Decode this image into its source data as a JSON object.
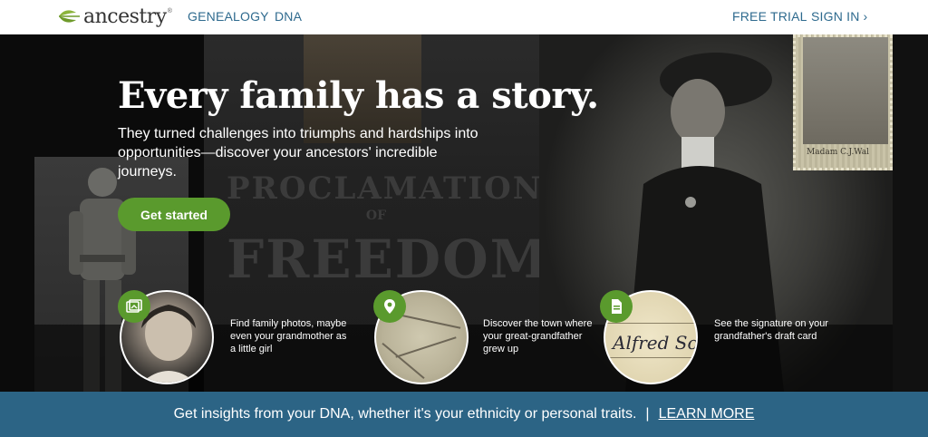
{
  "nav": {
    "logo_text": "ancestry",
    "logo_tm": "®",
    "genealogy": "GENEALOGY",
    "dna": "DNA",
    "free_trial": "FREE TRIAL",
    "sign_in": "SIGN IN"
  },
  "hero": {
    "title": "Every family has a story.",
    "subtitle": "They turned challenges into triumphs and hardships into opportunities—discover your ancestors' incredible journeys.",
    "cta_label": "Get started",
    "background_text": {
      "line1": "PROCLAMATION",
      "line2": "OF",
      "line3": "FREEDOM",
      "stamp_caption": "Madam C.J.Wal"
    }
  },
  "features": [
    {
      "icon": "photos-icon",
      "text": "Find family photos, maybe even your grandmother as a little girl"
    },
    {
      "icon": "location-pin-icon",
      "text": "Discover the town where your great-grandfather grew up"
    },
    {
      "icon": "document-icon",
      "text": "See the signature on your grandfather's draft card",
      "image_text": "Alfred Sol"
    }
  ],
  "dna_banner": {
    "text": "Get insights from your DNA, whether it's your ethnicity or personal traits.",
    "separator": "|",
    "link": "LEARN MORE"
  },
  "colors": {
    "brand_green": "#5a9a2d",
    "nav_blue": "#2e6a8e",
    "banner_blue": "#2c6485"
  }
}
